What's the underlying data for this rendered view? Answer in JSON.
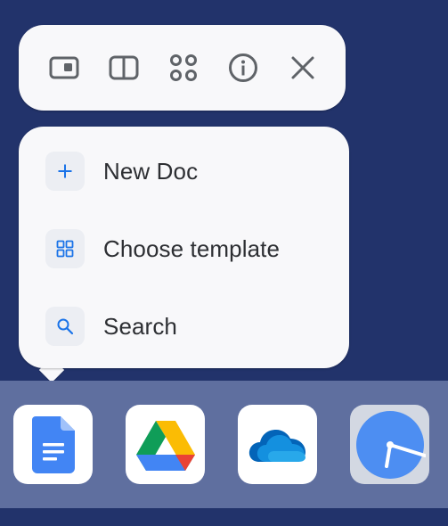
{
  "toolbar": {
    "buttons": [
      {
        "name": "picture-in-picture",
        "icon": "pip-window-icon"
      },
      {
        "name": "split-view",
        "icon": "split-screen-icon"
      },
      {
        "name": "apps-grid",
        "icon": "apps-grid-icon"
      },
      {
        "name": "info",
        "icon": "info-icon"
      },
      {
        "name": "close",
        "icon": "close-icon"
      }
    ]
  },
  "menu": {
    "items": [
      {
        "label": "New Doc",
        "icon": "plus-icon"
      },
      {
        "label": "Choose template",
        "icon": "template-grid-icon"
      },
      {
        "label": "Search",
        "icon": "search-icon"
      }
    ]
  },
  "shelf": {
    "apps": [
      {
        "name": "Google Docs",
        "icon": "google-docs-icon"
      },
      {
        "name": "Google Drive",
        "icon": "google-drive-icon"
      },
      {
        "name": "OneDrive",
        "icon": "onedrive-icon"
      },
      {
        "name": "Clock",
        "icon": "clock-icon"
      }
    ]
  },
  "colors": {
    "background": "#22336b",
    "shelf": "#5f6f9f",
    "card": "#f8f8fa",
    "accent_blue": "#1a73e8",
    "icon_gray": "#5f6368"
  }
}
